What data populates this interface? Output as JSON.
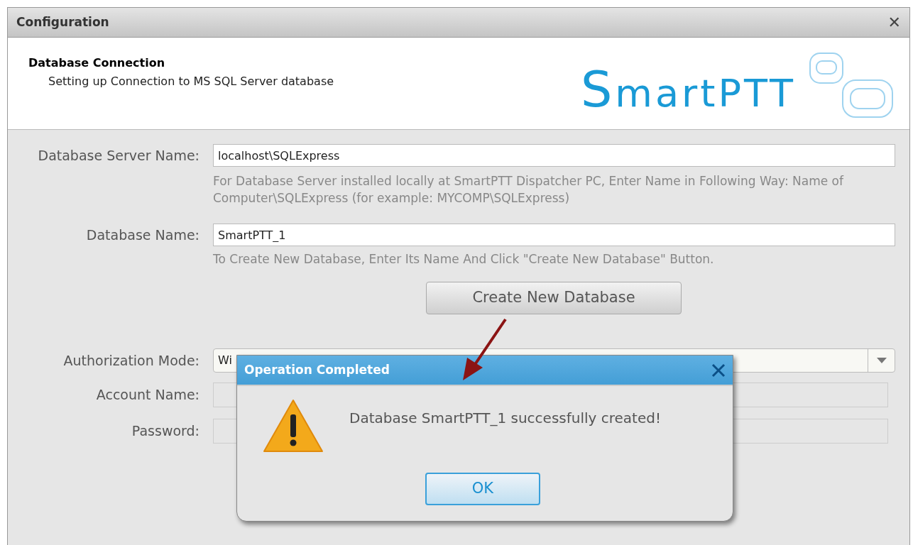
{
  "window": {
    "title": "Configuration",
    "close": "✕"
  },
  "header": {
    "title": "Database Connection",
    "subtitle": "Setting up Connection to MS SQL Server database",
    "logo": "SmartPTT"
  },
  "form": {
    "server": {
      "label": "Database Server Name:",
      "value": "localhost\\SQLExpress",
      "hint": "For Database Server installed locally at SmartPTT Dispatcher PC, Enter Name in Following Way: Name of Computer\\SQLExpress (for example: MYCOMP\\SQLExpress)"
    },
    "database": {
      "label": "Database Name:",
      "value": "SmartPTT_1",
      "hint": "To Create New Database, Enter Its Name And Click \"Create New Database\" Button."
    },
    "create_button": "Create New Database",
    "auth": {
      "label": "Authorization Mode:",
      "value": "Wi"
    },
    "account": {
      "label": "Account Name:"
    },
    "password": {
      "label": "Password:"
    }
  },
  "dialog": {
    "title": "Operation Completed",
    "message": "Database SmartPTT_1 successfully created!",
    "button": "OK"
  }
}
